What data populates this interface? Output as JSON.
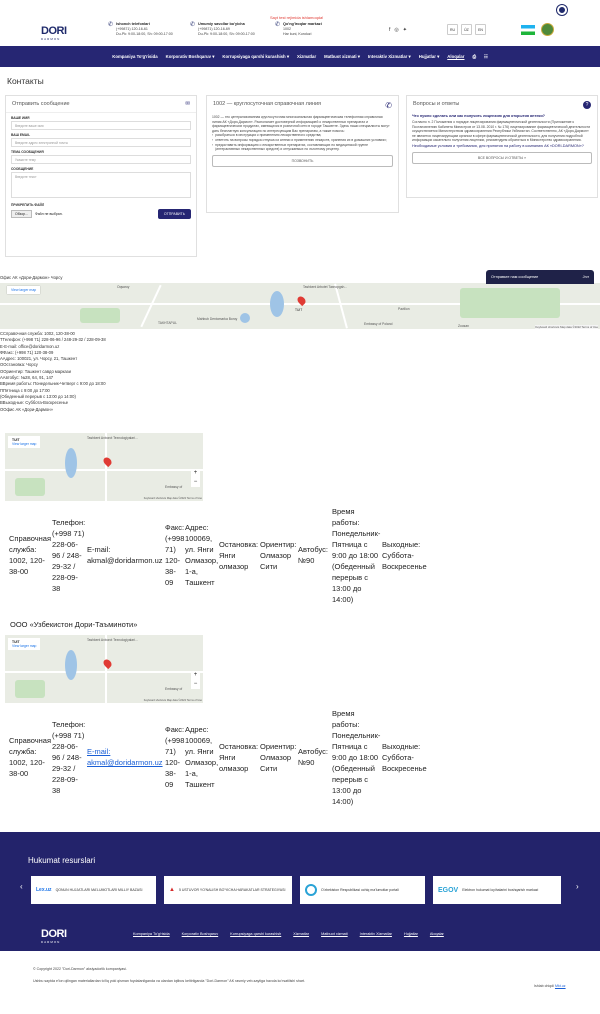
{
  "header": {
    "logo_main": "DORI",
    "logo_sub": "DARMON",
    "contacts": [
      {
        "title": "Ishonch telefonlari",
        "line1": "(+99871) 120-16-61",
        "line2": "Du-Pk: 9:00-18:00, Sh: 09:00-17:00"
      },
      {
        "title": "Umumiy savollar bo'yicha",
        "line1": "(+99871) 120-16-69",
        "line2": "Du-Pk: 9:00-18:00, Sh: 09:00-17:00"
      },
      {
        "title": "Qo'ng'iroqlar markazi",
        "line1": "1002",
        "line2": "Har kuni, Kunduzi"
      }
    ],
    "test_notice": "Sayt test rejimida ishlamoqda!",
    "langs": [
      "RU",
      "ÛZ",
      "EN"
    ]
  },
  "nav": {
    "items": [
      "Kompaniya To'g'risida",
      "Korporativ Boshqaruv",
      "Korrupsiyaga qarshi kurashish",
      "Xizmatlar",
      "Matbuot xizmati",
      "Interaktiv Xizmatlar",
      "Hujjatlar",
      "Aloqalar"
    ]
  },
  "page": {
    "title": "Контакты"
  },
  "form": {
    "title": "Отправить сообщение",
    "fields": [
      {
        "label": "ВАШЕ ИМЯ",
        "placeholder": "Введите ваше имя"
      },
      {
        "label": "ВАШ EMAIL",
        "placeholder": "Введите адрес электронной почты"
      },
      {
        "label": "ТЕМА СООБЩЕНИЯ",
        "placeholder": "Укажите тему"
      },
      {
        "label": "СООБЩЕНИЕ",
        "placeholder": "Введите текст"
      }
    ],
    "attach_label": "ПРИКРЕПИТЬ ФАЙЛ",
    "file_button": "Обзор...",
    "file_status": "Файл не выбран.",
    "submit": "ОТПРАВИТЬ"
  },
  "hotline": {
    "title": "1002 — круглосуточная справочная линия",
    "text": "1002 — это централизованная круглосуточная многоканальная фармацевтическая телефонная справочная линия АК «Дори-Дармон». Располагает достоверной информацией о лекарственных препаратах и фармацевтических продуктах, имеющихся в розничной сети в городе Ташкенте. Здесь наши специалисты могут дать бесплатную консультацию по интересующим Вас препаратам, а также помочь:",
    "bullets": [
      "разобраться в инструкции к применению лекарственного средства;",
      "ответить на вопросы порядка отпуска из аптеки и применению лекарств, хранения их в домашних условиях;",
      "предоставить информацию о лекарственных препаратах, составляющих по медицинской группе (интерактивных лекарственных средств) и отпускаемых по льготному рецепту."
    ],
    "button": "ПОЗВОНИТЬ"
  },
  "faq": {
    "title": "Вопросы и ответы",
    "question": "Что нужно сделать или как получить лицензию для открытия аптеки?",
    "answer": "Согласно п. 2 Положения о порядке лицензирования фармацевтической деятельности (Приложение к Постановлению Кабинета Министров от 13.08. 2010 г. № 176) лицензирование фармацевтической деятельности осуществляется Министерством здравоохранения Республики Узбекистан. Соответственно, АК «Дори-Дармон» не является лицензирующим органом в сфере фармацевтической деятельности, для получения подробной информации касательно получения лицензии, рекомендуем обратиться в Министерство здравоохранения.",
    "link": "Необходимые условия и требования, для принятия на работу в компанию АК «DORI-DARMON»?",
    "button": "ВСЕ ВОПРОСЫ И ОТВЕТЫ »"
  },
  "office": {
    "title": "Офис АК «Дори-Дармон» Чорсу",
    "view_larger": "View larger map",
    "chat": "Отправьте нам сообщение",
    "chat_action": "Jrvr",
    "map_labels": [
      "Tashkent Arbotet Taxnopgsh...",
      "Oqsaroy",
      "TAKHTAPUL",
      "Mahbub Dentomarka Boroy",
      "Olmazor",
      "TUIT",
      "Pavilion",
      "Embassy of Poland",
      "Zoosan",
      "Dorixona"
    ],
    "map_footer": "Keyboard shortcuts   Map data ©2022   Terms of Use"
  },
  "info_lines": [
    "CСправочная служба: 1002, 120-38-00",
    "TТелефон: (+998 71) 228-06-96 / 248-29-32 / 228-09-38",
    "E-E-mail: office@doridarmon.uz",
    "ФФакс: (+998 71) 120-38-09",
    "ААдрес: 100021, ул. Чорсу, 21, Ташкент",
    "ООстановка: Чорсу",
    "ООриентир: Ташкент савдо маркази",
    "ААвтобус: №28, 64, 91, 147",
    "ВВремя работы: Понедельник-Четверг с 9:00 до 18:00",
    "ППятница с 9:00 до 17:00",
    "(Обеденный перерыв с 13:00 до 14:00)",
    "ВВыходные: Суббота-Воскресенье",
    "ООфис АК «Дори-Дармон»"
  ],
  "branch_map": {
    "labels": [
      "TUIT",
      "View larger map",
      "Tashkent Axborot Texnologiyalari...",
      "Embassy of"
    ],
    "footer": "Keyboard shortcuts   Map data ©2022   Terms of Use"
  },
  "branch1": {
    "cols": [
      "Справочная служба: 1002, 120-38-00",
      "Телефон: (+998 71) 228-06-96 / 248-29-32 / 228-09-38",
      "E-mail: akmal@doridarmon.uz",
      "Факс: (+998 71) 120-38-09",
      "Адрес: 100069, ул. Янги Олмазор, 1-а, Ташкент",
      "Остановка: Янги олмазор",
      "Ориентир: Олмазор Сити",
      "Автобус: №90",
      "Время работы: Понедельник-Пятница с 9:00 до 18:00 (Обеденный перерыв с 13:00 до 14:00)",
      "Выходные: Суббота-Воскресенье"
    ]
  },
  "branch2": {
    "title": "ООО «Узбекистон Дори-Таъминоти»",
    "cols": [
      "Справочная служба: 1002, 120-38-00",
      "Телефон: (+998 71) 228-06-96 / 248-29-32 / 228-09-38",
      "E-mail: akmal@doridarmon.uz",
      "Факс: (+998 71) 120-38-09",
      "Адрес: 100069, ул. Янги Олмазор, 1-а, Ташкент",
      "Остановка: Янги олмазор",
      "Ориентир: Олмазор Сити",
      "Автобус: №90",
      "Время работы: Понедельник-Пятница с 9:00 до 18:00 (Обеденный перерыв с 13:00 до 14:00)",
      "Выходные: Суббота-Воскресенье"
    ]
  },
  "resources": {
    "title": "Hukumat resurslari",
    "items": [
      "QONUN HUJJATLARI MA'LUMOTLARI MILLIY BAZASI",
      "5 USTUVOR YO'NALISH BO'YICHA HARAKATLAR STRATEGIYASI",
      "O'zbekiston Respublikasi ochiq ma'lumotlar portali",
      "Elektron hukumat loyihalarini boshqarish markazi"
    ]
  },
  "footer": {
    "nav": [
      "Kompaniya To'g'risida",
      "Korporativ Boshqaruv",
      "Korrupsiyaga qarshi kurashish",
      "Xizmatlar",
      "Matbuot xizmati",
      "Interaktiv Xizmatlar",
      "Hujjatlar",
      "Aloqalar"
    ],
    "copyright": "© Copyright 2022 \"Dori-Darmon\" aksiyadorlik kompaniyasi.",
    "note": "Ushbu saytda e'lon qilingan materiallardan to'liq yoki qisman foydalanilganda va ulardan iqtibos keltirilganda \"Dori-Darmon\" AK rasmiy veb-saytiga havola ko'rsatilishi shart.",
    "dev_prefix": "Ishlab chiqdi",
    "dev_name": "Mkt.uz"
  }
}
